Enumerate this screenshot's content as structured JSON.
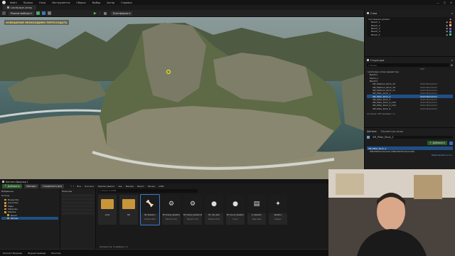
{
  "menu": {
    "items": [
      "Файл",
      "Правка",
      "Окно",
      "Инструменты",
      "Сборка",
      "Выбор",
      "Актер",
      "Справка"
    ]
  },
  "tabs": {
    "active": "Landscape.umap"
  },
  "toolbar": {
    "mode": "Режим выбора",
    "platforms": "Платформы"
  },
  "viewport": {
    "warning": "ОСВЕЩЕНИЕ НЕОБХОДИМО ПЕРЕСОЗДАТЬ"
  },
  "outliner": {
    "title": "Слои",
    "items": [
      "Системные уровни",
      "Beach_1",
      "Beach_2",
      "Beach_3",
      "Beach_4",
      "Beach_5"
    ]
  },
  "outliner2": {
    "title": "Структура",
    "search_placeholder": "Поиск",
    "column_type": "Тип",
    "items": [
      {
        "label": "Landscape.umap (редактор)",
        "type": "",
        "selected": false
      },
      {
        "label": "Beach1",
        "type": "",
        "selected": false
      },
      {
        "label": "Stairs_1",
        "type": "",
        "selected": false
      },
      {
        "label": "Beach2",
        "type": "",
        "selected": false
      },
      {
        "label": "SM_Medium_Rock_15",
        "type": "StaticMeshActor",
        "selected": false
      },
      {
        "label": "SM_Medium_Rock_16",
        "type": "StaticMeshActor",
        "selected": false
      },
      {
        "label": "SM_Medium_Rock_17",
        "type": "StaticMeshActor",
        "selected": false
      },
      {
        "label": "SM_Pillar_Rock_1",
        "type": "StaticMeshActor",
        "selected": false
      },
      {
        "label": "SM_Pillar_Rock_2",
        "type": "StaticMeshActor",
        "selected": true
      },
      {
        "label": "SM_Pillar_Rock_3",
        "type": "StaticMeshActor",
        "selected": false
      },
      {
        "label": "SM_Pillar_Rock_4_100",
        "type": "StaticMeshActor",
        "selected": false
      },
      {
        "label": "SM_Pillar_Rock_5_100",
        "type": "StaticMeshActor",
        "selected": false
      },
      {
        "label": "SM_Pillar_Rock_6",
        "type": "StaticMeshActor",
        "selected": false
      }
    ],
    "footer": "Актеров: 205 (выбран: 1)"
  },
  "details": {
    "title": "Детали",
    "tab2": "Параметры мира",
    "object": "SM_Pillar_Rock_2",
    "add_button": "Добавить",
    "component": "StaticMeshComponent (StaticMeshComponent0)",
    "edit_link": "Редактировать в С++"
  },
  "content_browser": {
    "title": "Контент-браузер 1",
    "add_button": "Добавить",
    "import_button": "Импорт",
    "save_button": "Сохранить все",
    "path": [
      "Все",
      "Контент",
      "Stylized_Nature",
      "Ass",
      "Meshes",
      "Beach",
      "Stones",
      "Cliffs"
    ],
    "sidebar_header": "Избранное",
    "tree_header": "Ассеты",
    "tree": [
      "Blueprints",
      "Geometry",
      "Maps",
      "Materials",
      "Meshes",
      "Beach",
      "Stones"
    ],
    "filter_header": "Фильтры",
    "search_placeholder": "Поиск в Cliffs",
    "assets": [
      {
        "name": "Arsto",
        "type": "",
        "kind": "folder"
      },
      {
        "name": "ISO",
        "type": "",
        "kind": "folder"
      },
      {
        "name": "BP_Skeleton",
        "type": "Skeletal Mesh",
        "kind": "mesh"
      },
      {
        "name": "BT_Dialog_Skeleton",
        "type": "Behavior Tree",
        "kind": "graph"
      },
      {
        "name": "BT_Dialog_Skeleton2",
        "type": "Behavior Tree",
        "kind": "graph"
      },
      {
        "name": "BT_Life_Skel",
        "type": "Behavior Tree",
        "kind": "circle"
      },
      {
        "name": "BT_Sound_Skeleton",
        "type": "Sound",
        "kind": "circle"
      },
      {
        "name": "D_Skeleton",
        "type": "Data Asset",
        "kind": "doc"
      },
      {
        "name": "Skeleton",
        "type": "Niagara",
        "kind": "star"
      }
    ],
    "footer": "Элементов: 9 (выбран: 1)"
  },
  "taskbar": {
    "items": [
      "Контент-браузер",
      "Журнал вывода",
      "Консоль"
    ]
  }
}
